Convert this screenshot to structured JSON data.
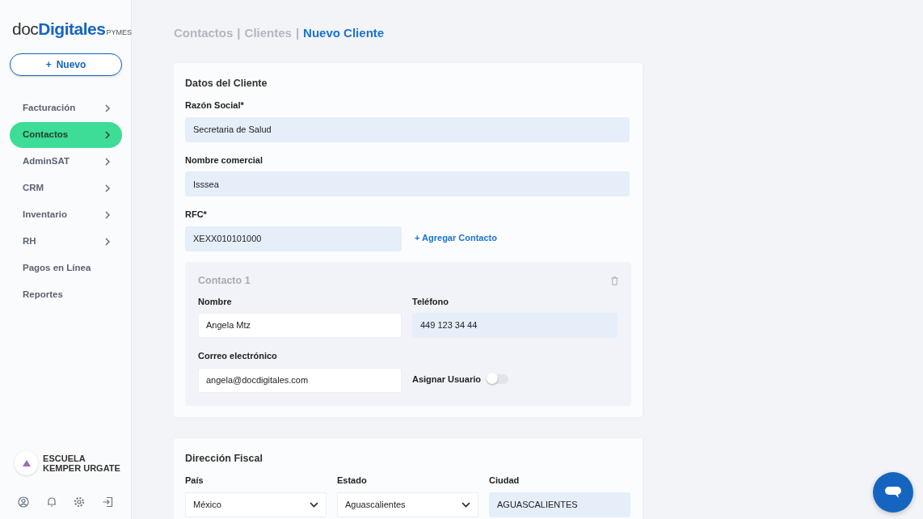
{
  "sidebar": {
    "logo": {
      "prefix": "doc",
      "main": "Digitales",
      "suffix": "PYMES"
    },
    "new_button": {
      "icon": "+",
      "label": "Nuevo"
    },
    "items": [
      {
        "label": "Facturación",
        "has_submenu": true,
        "selected": false
      },
      {
        "label": "Contactos",
        "has_submenu": true,
        "selected": true
      },
      {
        "label": "AdminSAT",
        "has_submenu": true,
        "selected": false
      },
      {
        "label": "CRM",
        "has_submenu": true,
        "selected": false
      },
      {
        "label": "Inventario",
        "has_submenu": true,
        "selected": false
      },
      {
        "label": "RH",
        "has_submenu": true,
        "selected": false
      },
      {
        "label": "Pagos en Línea",
        "has_submenu": false,
        "selected": false
      },
      {
        "label": "Reportes",
        "has_submenu": false,
        "selected": false
      }
    ],
    "account": {
      "name": "ESCUELA KEMPER URGATE"
    }
  },
  "breadcrumb": [
    {
      "kind": "link",
      "label": "Contactos",
      "selected": false
    },
    {
      "kind": "separator",
      "label": "|"
    },
    {
      "kind": "link",
      "label": "Clientes",
      "selected": false
    },
    {
      "kind": "separator",
      "label": "|"
    },
    {
      "kind": "link",
      "label": "Nuevo Cliente",
      "selected": true
    }
  ],
  "client_card": {
    "title": "Datos del Cliente",
    "fields": [
      {
        "label": "Razón Social*",
        "value": "Secretaria de Salud",
        "highlighted": true
      },
      {
        "label": "Nombre comercial",
        "value": "Isssea",
        "highlighted": true
      }
    ],
    "rfc": {
      "label": "RFC*",
      "value": "XEXX010101000",
      "highlighted": true
    },
    "add_contact_link": "+ Agregar Contacto",
    "contact": {
      "title": "Contacto 1",
      "fields": [
        {
          "label": "Nombre",
          "value": "Angela Mtz",
          "highlighted": false
        },
        {
          "label": "Teléfono",
          "value": "449 123 34 44",
          "highlighted": true
        },
        {
          "label": "Correo electrónico",
          "value": "angela@docdigitales.com",
          "highlighted": false
        }
      ],
      "assign_user": {
        "label": "Asignar Usuario",
        "on": false
      }
    }
  },
  "address_card": {
    "title": "Dirección Fiscal",
    "fields": [
      {
        "kind": "select",
        "label": "País",
        "value": "México",
        "highlighted": false
      },
      {
        "kind": "select",
        "label": "Estado",
        "value": "Aguascalientes",
        "highlighted": false
      },
      {
        "kind": "text",
        "label": "Ciudad",
        "value": "AGUASCALIENTES",
        "highlighted": true
      }
    ]
  }
}
